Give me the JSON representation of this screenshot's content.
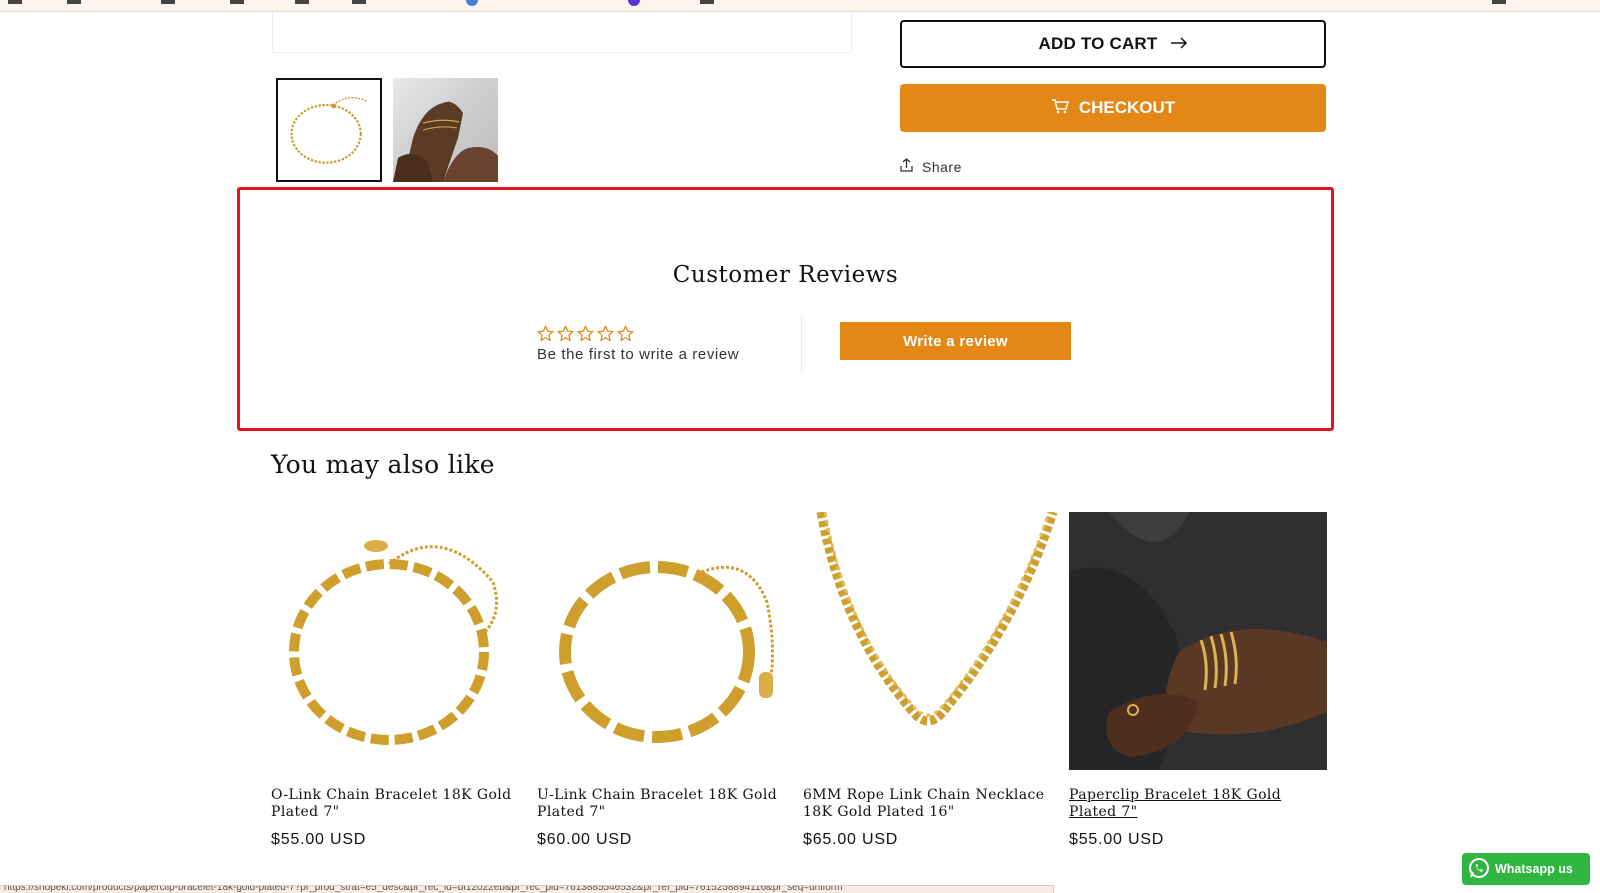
{
  "product_actions": {
    "add_to_cart_label": "ADD TO CART",
    "checkout_label": "CHECKOUT",
    "share_label": "Share"
  },
  "reviews": {
    "title": "Customer Reviews",
    "rating": 0,
    "max_rating": 5,
    "empty_text": "Be the first to write a review",
    "write_button_label": "Write a review"
  },
  "related": {
    "heading": "You may also like",
    "products": [
      {
        "name": "O-Link Chain Bracelet 18K Gold Plated 7\"",
        "price": "$55.00 USD"
      },
      {
        "name": "U-Link Chain Bracelet 18K Gold Plated 7\"",
        "price": "$60.00 USD"
      },
      {
        "name": "6MM Rope Link Chain Necklace 18K Gold Plated 16\"",
        "price": "$65.00 USD"
      },
      {
        "name": "Paperclip Bracelet 18K Gold Plated 7\"",
        "price": "$55.00 USD"
      }
    ]
  },
  "whatsapp": {
    "label": "Whatsapp us"
  },
  "status_bar": {
    "url": "https://shopeki.com/products/paperclip-bracelet-18k-gold-plated-7?pr_prod_strat=e5_desc&pr_rec_id=bf12022eb&pr_rec_pid=7613885546532&pr_ref_pid=7615258894116&pr_seq=uniform"
  },
  "colors": {
    "accent": "#e38816",
    "highlight_border": "#e8101a",
    "whatsapp": "#2fb540"
  },
  "icons": {
    "cart": "cart-icon",
    "arrow": "arrow-right-icon",
    "share": "share-icon",
    "star": "star-outline-icon",
    "whatsapp": "whatsapp-icon"
  }
}
